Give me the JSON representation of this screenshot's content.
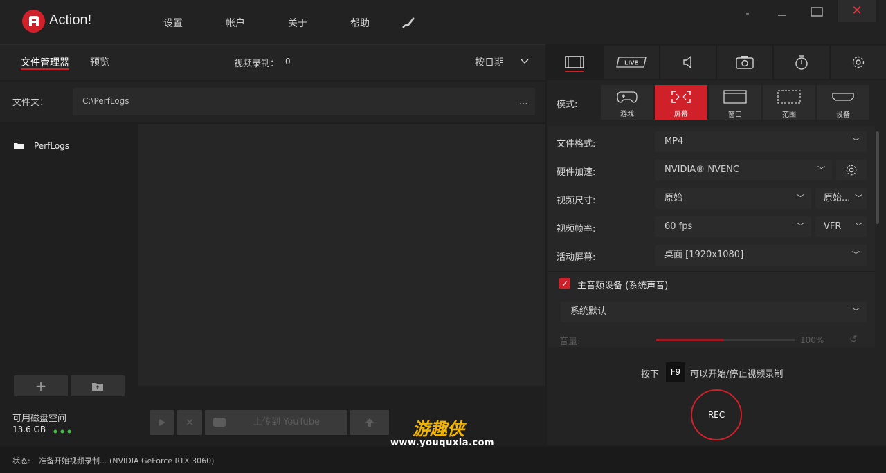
{
  "app": {
    "title": "Action!"
  },
  "menu": {
    "settings": "设置",
    "account": "帐户",
    "about": "关于",
    "help": "帮助"
  },
  "window": {
    "minimize": "-",
    "maximize": "☐",
    "close": "✕"
  },
  "left": {
    "tabs": [
      "文件管理器",
      "预览"
    ],
    "video_count_label": "视频录制：",
    "video_count_value": "0",
    "sort_label": "按日期",
    "folder_label": "文件夹：",
    "folder_path": "C:\\PerfLogs",
    "folder_more": "...",
    "tree_items": [
      "PerfLogs"
    ],
    "disk_label": "可用磁盘空间",
    "disk_value": "13.6 GB",
    "upload_label": "上传到 YouTube"
  },
  "right": {
    "mode_label": "模式:",
    "modes": [
      "游戏",
      "屏幕",
      "窗口",
      "范围",
      "设备"
    ],
    "rows": {
      "format": {
        "label": "文件格式:",
        "value": "MP4"
      },
      "hw": {
        "label": "硬件加速:",
        "value": "NVIDIA® NVENC"
      },
      "size": {
        "label": "视频尺寸:",
        "value": "原始",
        "value2": "原始..."
      },
      "fps": {
        "label": "视频帧率:",
        "value": "60 fps",
        "value2": "VFR"
      },
      "screen": {
        "label": "活动屏幕:",
        "value": "桌面 [1920x1080]"
      }
    },
    "audio_label": "主音频设备 (系统声音)",
    "audio_device": "系统默认",
    "volume_label": "音量:",
    "volume_value": "100%",
    "hint_prefix": "按下",
    "hint_key": "F9",
    "hint_suffix": "可以开始/停止视频录制",
    "rec_label": "REC"
  },
  "status": {
    "label": "状态:",
    "text": "准备开始视频录制... (NVIDIA GeForce RTX 3060)"
  },
  "watermark": {
    "main": "游趣侠",
    "sub": "www.youquxia.com"
  },
  "colors": {
    "accent": "#d0202a",
    "bg": "#1e1e1e",
    "panel": "#232323"
  }
}
